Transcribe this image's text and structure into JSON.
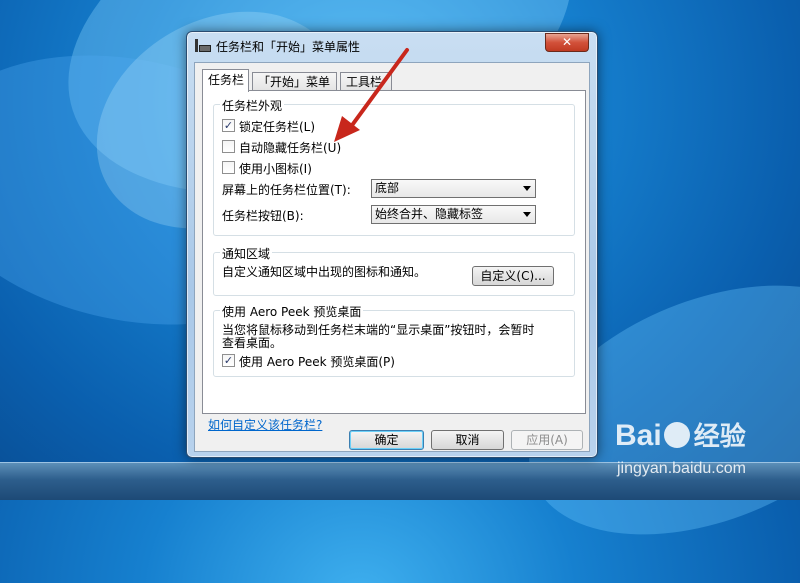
{
  "window": {
    "title": "任务栏和「开始」菜单属性",
    "close_symbol": "✕"
  },
  "tabs": [
    {
      "label": "任务栏",
      "active": true
    },
    {
      "label": "「开始」菜单",
      "active": false
    },
    {
      "label": "工具栏",
      "active": false
    }
  ],
  "appearance": {
    "group_label": "任务栏外观",
    "lock_taskbar": {
      "label": "锁定任务栏(L)",
      "checked": true
    },
    "auto_hide": {
      "label": "自动隐藏任务栏(U)",
      "checked": false
    },
    "small_icons": {
      "label": "使用小图标(I)",
      "checked": false
    },
    "location_label": "屏幕上的任务栏位置(T):",
    "location_value": "底部",
    "buttons_label": "任务栏按钮(B):",
    "buttons_value": "始终合并、隐藏标签"
  },
  "notification": {
    "group_label": "通知区域",
    "description": "自定义通知区域中出现的图标和通知。",
    "customize_button": "自定义(C)..."
  },
  "aero_peek": {
    "group_label": "使用 Aero Peek 预览桌面",
    "description_line1": "当您将鼠标移动到任务栏末端的“显示桌面”按钮时，会暂时",
    "description_line2": "查看桌面。",
    "checkbox": {
      "label": "使用 Aero Peek 预览桌面(P)",
      "checked": true
    }
  },
  "help_link": "如何自定义该任务栏?",
  "footer": {
    "ok": "确定",
    "cancel": "取消",
    "apply": "应用(A)"
  },
  "watermark": {
    "logo_a": "Bai",
    "logo_b": "经验",
    "url": "jingyan.baidu.com"
  },
  "colors": {
    "annotation_arrow": "#c8271c",
    "link": "#0066cc"
  },
  "icons": [
    "taskbar-properties-icon",
    "close-icon",
    "checkbox-check-icon",
    "dropdown-arrow-icon",
    "annotation-arrow-icon",
    "baidu-paw-icon"
  ]
}
